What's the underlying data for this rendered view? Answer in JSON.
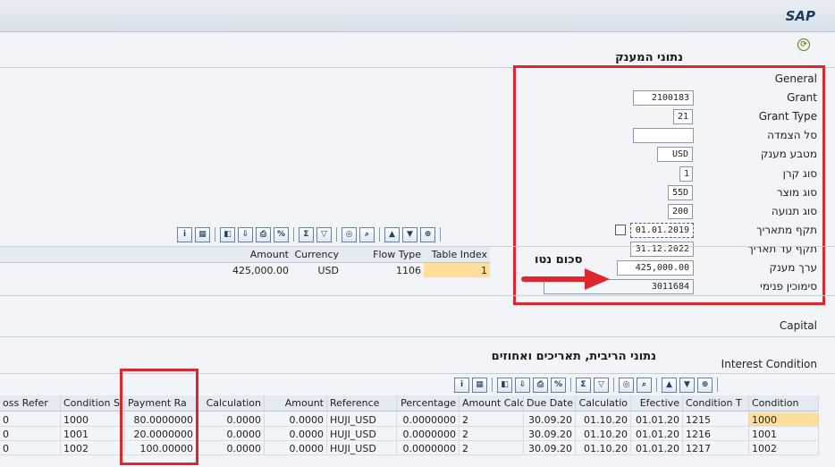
{
  "window": {
    "brand": "SAP"
  },
  "grant_section": {
    "title": "נתוני המענק",
    "group_label": "General",
    "fields": [
      {
        "label": "Grant",
        "value": "2100183"
      },
      {
        "label": "Grant Type",
        "value": "21"
      },
      {
        "label": "סל הצמדה",
        "value": ""
      },
      {
        "label": "מטבע מענק",
        "value": "USD"
      },
      {
        "label": "סוג קרן",
        "value": "1"
      },
      {
        "label": "סוג מוצר",
        "value": "55D"
      },
      {
        "label": "סוג תנועה",
        "value": "200"
      },
      {
        "label": "תקף מתאריך",
        "value": "01.01.2019"
      },
      {
        "label": "תקף עד תאריך",
        "value": "31.12.2022"
      },
      {
        "label": "ערך מענק",
        "value": "425,000.00"
      },
      {
        "label": "סימוכין פנימי",
        "value": "3011684"
      }
    ],
    "annotation": "סכום נטו"
  },
  "amount_table": {
    "columns": [
      "Amount",
      "Currency",
      "Flow Type",
      "Table Index"
    ],
    "rows": [
      [
        "425,000.00",
        "USD",
        "1106",
        "1"
      ]
    ]
  },
  "capital_label": "Capital",
  "interest_section": {
    "title": "נתוני הריבית, תאריכים ואחוזים",
    "group_label": "Interest Condition",
    "columns": [
      "oss Refer",
      "Condition S",
      "Payment Ra",
      "Calculation",
      "Amount",
      "Reference",
      "Percentage",
      "Amount Calc",
      "Due Date",
      "Calculatio",
      "Efective",
      "Condition T",
      "Condition"
    ],
    "rows": [
      [
        "0",
        "1000",
        "80.0000000",
        "0.0000",
        "0.0000",
        "HUJI_USD",
        "0.0000000",
        "2",
        "30.09.20",
        "01.10.20",
        "01.01.20",
        "1215",
        "1000"
      ],
      [
        "0",
        "1001",
        "20.0000000",
        "0.0000",
        "0.0000",
        "HUJI_USD",
        "0.0000000",
        "2",
        "30.09.20",
        "01.10.20",
        "01.01.20",
        "1216",
        "1001"
      ],
      [
        "0",
        "1002",
        "100.00000",
        "0.0000",
        "0.0000",
        "HUJI_USD",
        "0.0000000",
        "2",
        "30.09.20",
        "01.10.20",
        "01.01.20",
        "1217",
        "1002"
      ]
    ]
  },
  "toolbar_icons": [
    "details-icon",
    "grid-icon",
    "layout-icon",
    "export-icon",
    "print-icon",
    "percent-icon",
    "sum-icon",
    "filter-icon",
    "binoculars-icon",
    "find-icon",
    "sort-asc-icon",
    "sort-desc-icon",
    "zoom-icon"
  ],
  "colors": {
    "highlight": "#ffdf9a",
    "annotation_red": "#e0262d"
  }
}
